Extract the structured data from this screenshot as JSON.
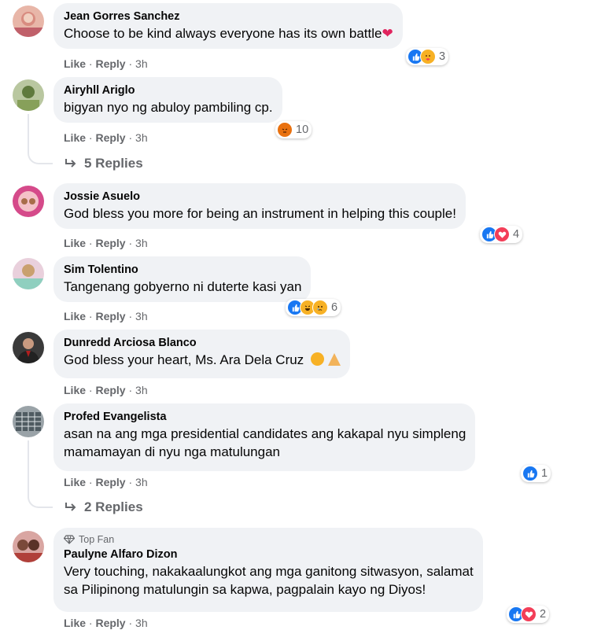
{
  "comments": [
    {
      "author": "Jean Gorres Sanchez",
      "text": "Choose to be kind always everyone has its own battle",
      "like": "Like",
      "reply": "Reply",
      "time": "3h",
      "reaction_count": "3",
      "reactions": [
        "like-icon",
        "care-icon"
      ],
      "inline_emoji": "heart"
    },
    {
      "author": "Airyhll Ariglo",
      "text": "bigyan nyo ng abuloy pambiling cp.",
      "like": "Like",
      "reply": "Reply",
      "time": "3h",
      "reaction_count": "10",
      "reactions": [
        "angry-icon"
      ],
      "replies": "5 Replies"
    },
    {
      "author": "Jossie Asuelo",
      "text": "God bless you more for being an instrument in helping this couple!",
      "like": "Like",
      "reply": "Reply",
      "time": "3h",
      "reaction_count": "4",
      "reactions": [
        "like-icon",
        "love-icon"
      ]
    },
    {
      "author": "Sim Tolentino",
      "text": "Tangenang gobyerno ni duterte kasi yan",
      "like": "Like",
      "reply": "Reply",
      "time": "3h",
      "reaction_count": "6",
      "reactions": [
        "like-icon",
        "haha-icon",
        "sad-icon"
      ]
    },
    {
      "author": "Dunredd Arciosa Blanco",
      "text": "God bless your heart, Ms. Ara Dela Cruz",
      "like": "Like",
      "reply": "Reply",
      "time": "3h",
      "inline_emoji": "relieved-face, folded-hands"
    },
    {
      "author": "Profed Evangelista",
      "text_line1": "asan na ang mga presidential candidates ang kakapal nyu simpleng",
      "text_line2": "mamamayan di nyu nga matulungan",
      "like": "Like",
      "reply": "Reply",
      "time": "3h",
      "reaction_count": "1",
      "reactions": [
        "like-icon"
      ],
      "replies": "2 Replies"
    },
    {
      "badge": "Top Fan",
      "author": "Paulyne Alfaro Dizon",
      "text_line1": "Very touching, nakakaalungkot ang mga ganitong sitwasyon, salamat",
      "text_line2": "sa Pilipinong matulungin sa kapwa, pagpalain kayo ng Diyos!",
      "like": "Like",
      "reply": "Reply",
      "time": "3h",
      "reaction_count": "2",
      "reactions": [
        "like-icon",
        "love-icon"
      ]
    }
  ],
  "colors": {
    "bubble": "#f0f2f5",
    "meta": "#65676b",
    "like": "#1877f2",
    "love": "#f33e58",
    "angry": "#e9710f",
    "emoji_yellow": "#f7b125"
  }
}
